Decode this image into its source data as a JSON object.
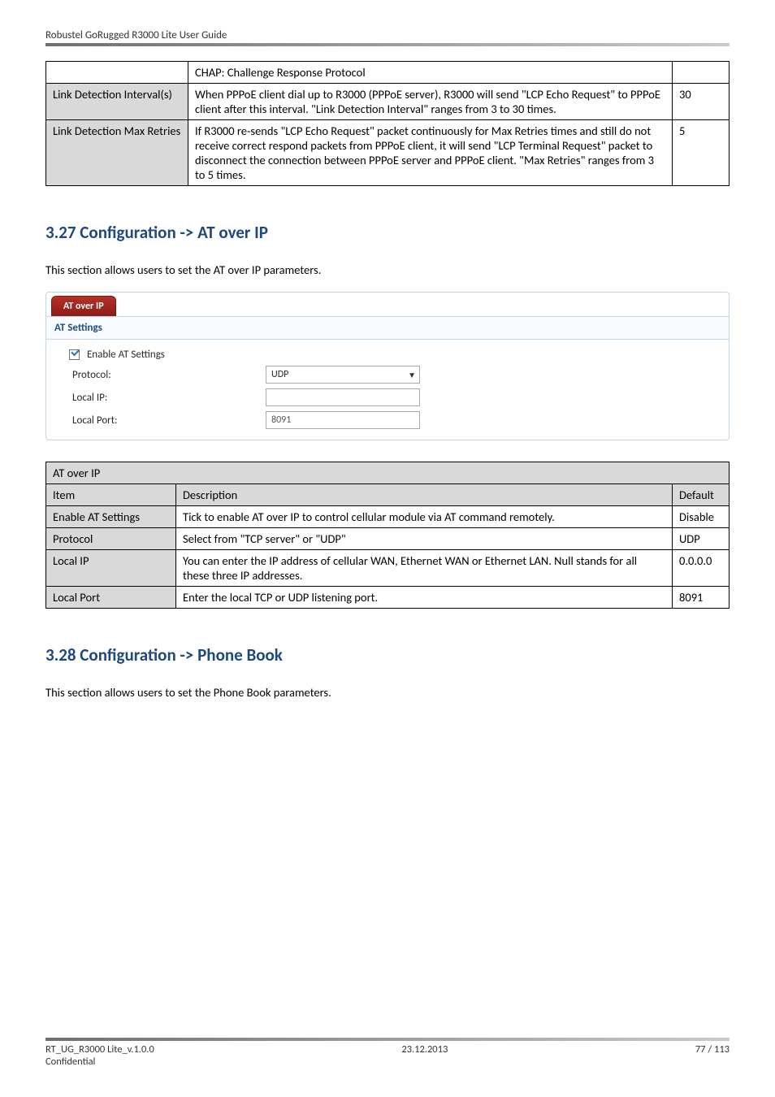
{
  "header": {
    "title": "Robustel GoRugged R3000 Lite User Guide"
  },
  "table1": {
    "r1c2": "CHAP: Challenge Response Protocol",
    "r2c1": "Link Detection Interval(s)",
    "r2c2": "When PPPoE client dial up to R3000 (PPPoE server), R3000 will send \"LCP Echo Request\" to PPPoE client after this interval. \"Link Detection Interval\" ranges from 3 to 30 times.",
    "r2c3": "30",
    "r3c1": "Link Detection Max Retries",
    "r3c2": "If R3000 re-sends \"LCP Echo Request\" packet continuously for Max Retries times and still do not receive correct respond packets from PPPoE client, it will send \"LCP Terminal Request\" packet to disconnect the connection between PPPoE server and PPPoE client. \"Max Retries\" ranges from 3 to 5 times.",
    "r3c3": "5"
  },
  "section327": {
    "heading": "3.27  Configuration -> AT over IP",
    "intro": "This section allows users to set the AT over IP parameters."
  },
  "panel": {
    "tab": "AT over IP",
    "section_title": "AT Settings",
    "enable_label": "Enable AT Settings",
    "protocol_label": "Protocol:",
    "protocol_value": "UDP",
    "localip_label": "Local IP:",
    "localip_value": "",
    "localport_label": "Local Port:",
    "localport_value": "8091"
  },
  "table2": {
    "title": "AT over IP",
    "h_item": "Item",
    "h_desc": "Description",
    "h_def": "Default",
    "r1c1": "Enable AT Settings",
    "r1c2": "Tick to enable AT over IP to control cellular module via AT command remotely.",
    "r1c3": "Disable",
    "r2c1": "Protocol",
    "r2c2": "Select from \"TCP server\" or \"UDP\"",
    "r2c3": "UDP",
    "r3c1": "Local IP",
    "r3c2": "You can enter the IP address of cellular WAN, Ethernet WAN or Ethernet LAN. Null stands for all these three IP addresses.",
    "r3c3": "0.0.0.0",
    "r4c1": "Local Port",
    "r4c2": "Enter the local TCP or UDP listening port.",
    "r4c3": "8091"
  },
  "section328": {
    "heading": "3.28  Configuration -> Phone Book",
    "intro": "This section allows users to set the Phone Book parameters."
  },
  "footer": {
    "left1": "RT_UG_R3000 Lite_v.1.0.0",
    "left2": "Confidential",
    "center": "23.12.2013",
    "right": "77 / 113"
  }
}
